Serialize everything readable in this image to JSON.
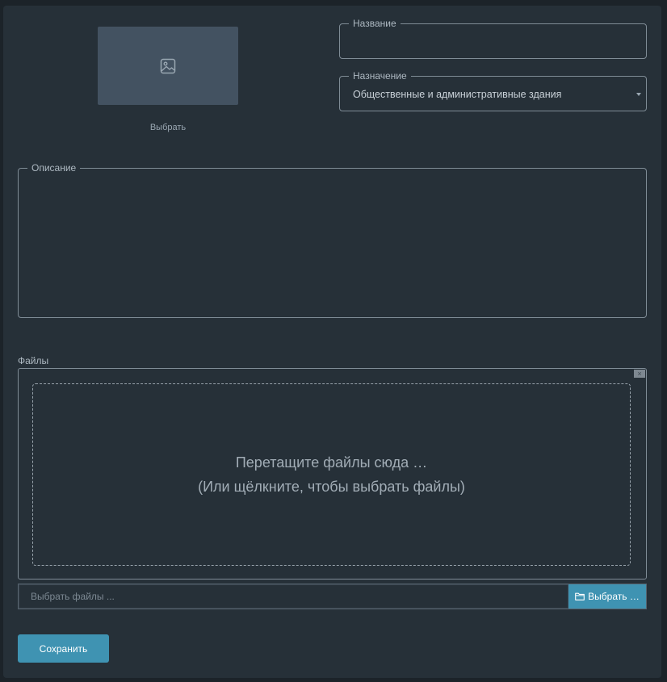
{
  "image_picker": {
    "icon": "image-icon",
    "select_label": "Выбрать"
  },
  "fields": {
    "name": {
      "label": "Название",
      "value": ""
    },
    "purpose": {
      "label": "Назначение",
      "value": "Общественные и административные здания"
    },
    "description": {
      "label": "Описание",
      "value": ""
    }
  },
  "files": {
    "label": "Файлы",
    "close_glyph": "×",
    "drop_line1": "Перетащите файлы сюда …",
    "drop_line2": "(Или щёлкните, чтобы выбрать файлы)",
    "input_placeholder": "Выбрать файлы ...",
    "browse_icon": "folder-icon",
    "browse_label": "Выбрать …"
  },
  "actions": {
    "save_label": "Сохранить"
  },
  "colors": {
    "background": "#1c2329",
    "panel": "#263038",
    "accent": "#3f93b2",
    "image_placeholder": "#435261"
  }
}
